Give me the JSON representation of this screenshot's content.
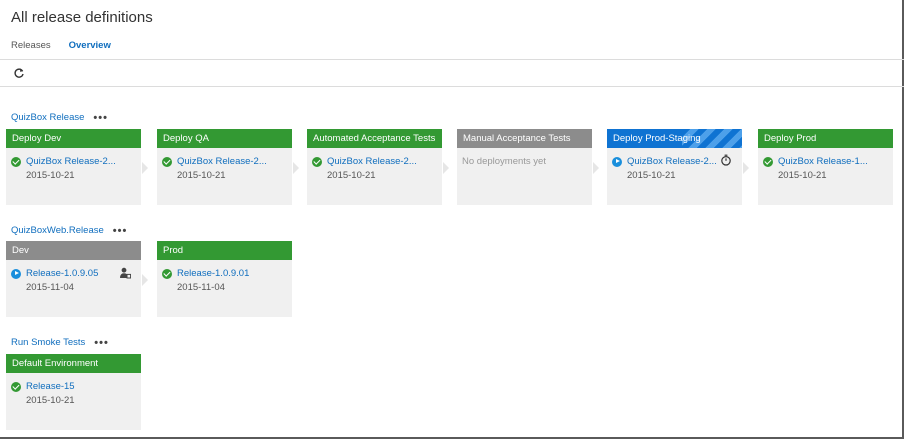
{
  "page": {
    "title": "All release definitions"
  },
  "tabs": [
    {
      "label": "Releases",
      "active": false
    },
    {
      "label": "Overview",
      "active": true
    }
  ],
  "toolbar": {
    "refresh_icon": "refresh-icon"
  },
  "colors": {
    "accent": "#106ebe",
    "success": "#339933",
    "not_deployed": "#8c8c8c",
    "in_progress": "#0f73d2",
    "card_bg": "#f0f0f0"
  },
  "definitions": [
    {
      "name": "QuizBox Release",
      "menu": "•••",
      "environments": [
        {
          "name": "Deploy Dev",
          "status": "success",
          "release": "QuizBox Release-2...",
          "date": "2015-10-21"
        },
        {
          "name": "Deploy QA",
          "status": "success",
          "release": "QuizBox Release-2...",
          "date": "2015-10-21"
        },
        {
          "name": "Automated Acceptance Tests",
          "status": "success",
          "release": "QuizBox Release-2...",
          "date": "2015-10-21"
        },
        {
          "name": "Manual Acceptance Tests",
          "status": "none",
          "message": "No deployments yet"
        },
        {
          "name": "Deploy Prod-Staging",
          "status": "in-progress",
          "release": "QuizBox Release-2...",
          "date": "2015-10-21",
          "side_icon": "timer-icon"
        },
        {
          "name": "Deploy Prod",
          "status": "success",
          "release": "QuizBox Release-1...",
          "date": "2015-10-21"
        }
      ]
    },
    {
      "name": "QuizBoxWeb.Release",
      "menu": "•••",
      "environments": [
        {
          "name": "Dev",
          "status": "in-progress",
          "release": "Release-1.0.9.05",
          "date": "2015-11-04",
          "side_icon": "approver-icon"
        },
        {
          "name": "Prod",
          "status": "success",
          "release": "Release-1.0.9.01",
          "date": "2015-11-04"
        }
      ]
    },
    {
      "name": "Run Smoke Tests",
      "menu": "•••",
      "environments": [
        {
          "name": "Default Environment",
          "status": "success",
          "release": "Release-15",
          "date": "2015-10-21"
        }
      ]
    }
  ]
}
